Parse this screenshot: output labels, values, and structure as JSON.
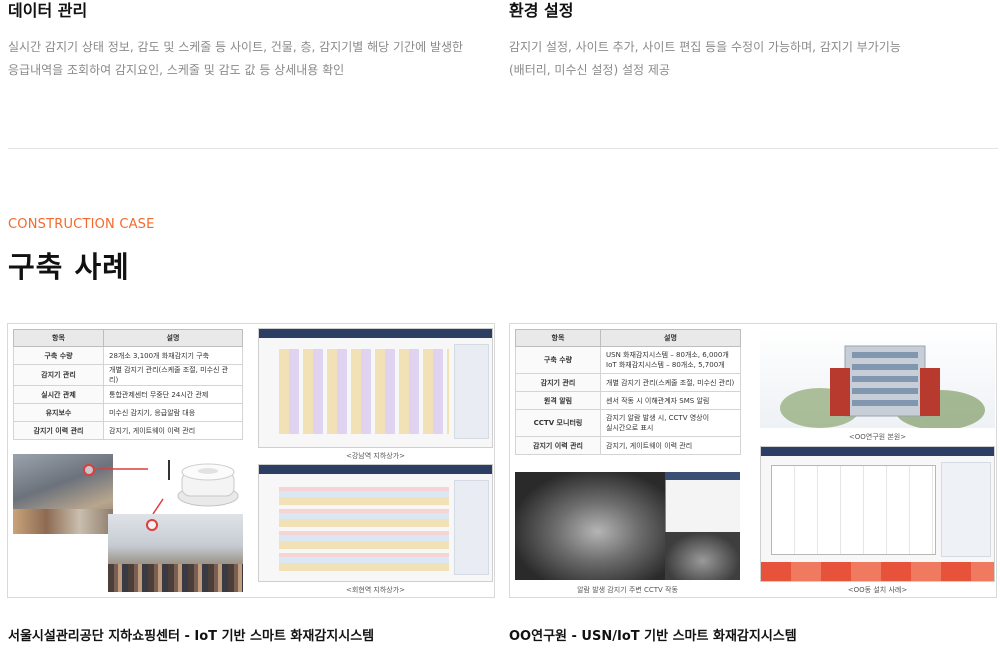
{
  "features": [
    {
      "title": "데이터 관리",
      "desc_line1": "실시간 감지기 상태 정보, 감도 및 스케줄 등 사이트, 건물, 층, 감지기별 해당 기간에 발생한",
      "desc_line2": "응급내역을 조회하여 감지요인, 스케줄 및 감도 값 등 상세내용 확인"
    },
    {
      "title": "환경 설정",
      "desc_line1": "감지기 설정, 사이트 추가, 사이트 편집 등을 수정이 가능하며, 감지기 부가기능",
      "desc_line2": "(배터리, 미수신 설정) 설정 제공"
    }
  ],
  "section": {
    "eyebrow": "CONSTRUCTION CASE",
    "title": "구축 사례"
  },
  "cases": [
    {
      "caption": "서울시설관리공단 지하쇼핑센터 - IoT 기반 스마트 화재감지시스템",
      "table_headers": [
        "항목",
        "설명"
      ],
      "rows": [
        [
          "구축 수량",
          "28개소 3,100개 화재감지기 구축"
        ],
        [
          "감지기 관리",
          "개별 감지기 관리(스케줄 조절, 미수신 관리)"
        ],
        [
          "실시간 관제",
          "통합관제센터 무중단 24시간 관제"
        ],
        [
          "유지보수",
          "미수신 감지기, 응급알람 대응"
        ],
        [
          "감지기 이력 관리",
          "감지기, 게이트웨이 이력 관리"
        ]
      ],
      "thumb_labels": [
        "<강남역 지하상가>",
        "<회현역 지하상가>"
      ]
    },
    {
      "caption": "OO연구원 - USN/IoT 기반 스마트 화재감지시스템",
      "table_headers": [
        "항목",
        "설명"
      ],
      "rows": [
        [
          "구축 수량",
          "USN 화재감지시스템 – 80개소, 6,000개",
          "IoT 화재감지시스템 – 80개소, 5,700개"
        ],
        [
          "감지기 관리",
          "개별 감지기 관리(스케줄 조절, 미수신 관리)"
        ],
        [
          "원격 알림",
          "센서 작동 시 이해관계자 SMS 알림"
        ],
        [
          "CCTV 모니터링",
          "감지기 알람 발생 시, CCTV 영상이",
          "실시간으로 표시"
        ],
        [
          "감지기 이력 관리",
          "감지기, 게이트웨이 이력 관리"
        ]
      ],
      "thumb_labels": [
        "<OO연구원 본원>",
        "<OO동 설치 사례>"
      ],
      "cctv_label": "알람 발생 감지기 주변 CCTV 작동"
    }
  ],
  "colors": {
    "accent": "#f26a2e",
    "divider": "#e3e3e3",
    "muted_text": "#8a8a8a"
  }
}
